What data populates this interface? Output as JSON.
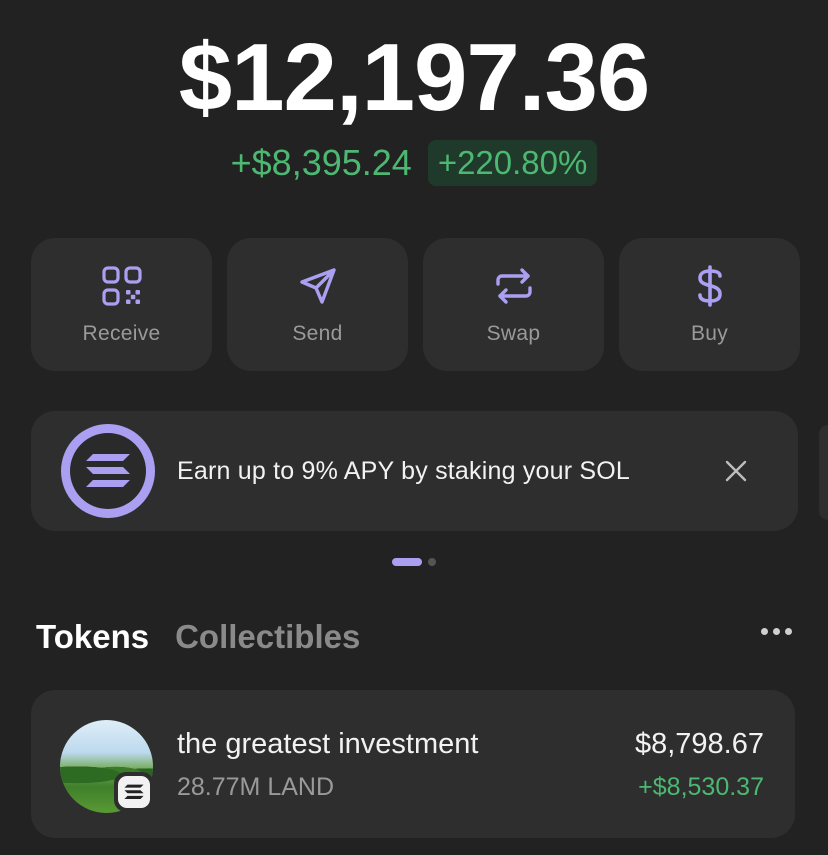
{
  "balance": {
    "total": "$12,197.36",
    "change_amount": "+$8,395.24",
    "change_percent": "+220.80%"
  },
  "actions": [
    {
      "label": "Receive",
      "icon": "qr-code-icon"
    },
    {
      "label": "Send",
      "icon": "send-icon"
    },
    {
      "label": "Swap",
      "icon": "swap-icon"
    },
    {
      "label": "Buy",
      "icon": "dollar-icon"
    }
  ],
  "promo": {
    "text": "Earn up to 9% APY by staking your SOL",
    "icon": "solana-logo-icon",
    "close_icon": "close-icon"
  },
  "tabs": {
    "tokens": "Tokens",
    "collectibles": "Collectibles",
    "active": "tokens"
  },
  "tokens": [
    {
      "name": "the greatest investment",
      "amount": "28.77M LAND",
      "value": "$8,798.67",
      "change": "+$8,530.37"
    }
  ],
  "colors": {
    "accent": "#ab9ff2",
    "positive": "#4cb871",
    "background": "#222222",
    "card": "#2e2e2e"
  }
}
